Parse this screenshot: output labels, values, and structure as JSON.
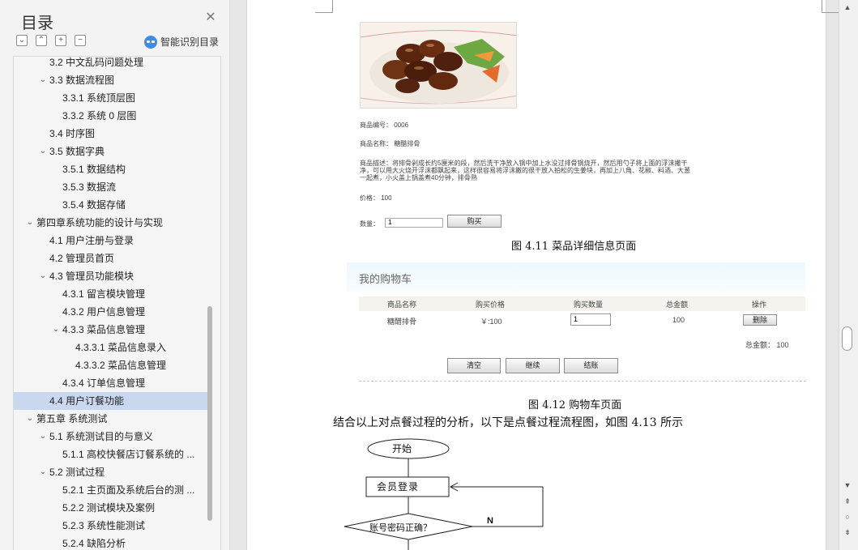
{
  "sidebar": {
    "title": "目录",
    "smart_toc_label": "智能识别目录",
    "tools": [
      "expand-all",
      "collapse-all",
      "add-heading",
      "remove-heading"
    ],
    "items": [
      {
        "label": "3.2 中文乱码问题处理",
        "level": 2,
        "expanded": null
      },
      {
        "label": "3.3 数据流程图",
        "level": 2,
        "expanded": true
      },
      {
        "label": "3.3.1 系统顶层图",
        "level": 3,
        "expanded": null
      },
      {
        "label": "3.3.2 系统 0 层图",
        "level": 3,
        "expanded": null
      },
      {
        "label": "3.4 时序图",
        "level": 2,
        "expanded": null
      },
      {
        "label": "3.5  数据字典",
        "level": 2,
        "expanded": true
      },
      {
        "label": "3.5.1  数据结构",
        "level": 3,
        "expanded": null
      },
      {
        "label": "3.5.3  数据流",
        "level": 3,
        "expanded": null
      },
      {
        "label": "3.5.4 数据存储",
        "level": 3,
        "expanded": null
      },
      {
        "label": "第四章系统功能的设计与实现",
        "level": 1,
        "expanded": true
      },
      {
        "label": "4.1 用户注册与登录",
        "level": 2,
        "expanded": null
      },
      {
        "label": "4.2 管理员首页",
        "level": 2,
        "expanded": null
      },
      {
        "label": "4.3 管理员功能模块",
        "level": 2,
        "expanded": true
      },
      {
        "label": "4.3.1 留言模块管理",
        "level": 3,
        "expanded": null
      },
      {
        "label": "4.3.2 用户信息管理",
        "level": 3,
        "expanded": null
      },
      {
        "label": "4.3.3 菜品信息管理",
        "level": 3,
        "expanded": true
      },
      {
        "label": "4.3.3.1 菜品信息录入",
        "level": 4,
        "expanded": null
      },
      {
        "label": "4.3.3.2 菜品信息管理",
        "level": 4,
        "expanded": null
      },
      {
        "label": "4.3.4 订单信息管理",
        "level": 3,
        "expanded": null
      },
      {
        "label": "4.4 用户订餐功能",
        "level": 2,
        "expanded": null,
        "selected": true
      },
      {
        "label": "第五章  系统测试",
        "level": 1,
        "expanded": true
      },
      {
        "label": "5.1 系统测试目的与意义",
        "level": 2,
        "expanded": true
      },
      {
        "label": "5.1.1  高校快餐店订餐系统的 ...",
        "level": 3,
        "expanded": null
      },
      {
        "label": "5.2 测试过程",
        "level": 2,
        "expanded": true
      },
      {
        "label": "5.2.1 主页面及系统后台的测 ...",
        "level": 3,
        "expanded": null
      },
      {
        "label": "5.2.2 测试模块及案例",
        "level": 3,
        "expanded": null
      },
      {
        "label": "5.2.3 系统性能测试",
        "level": 3,
        "expanded": null
      },
      {
        "label": "5.2.4 缺陷分析",
        "level": 3,
        "expanded": null
      }
    ]
  },
  "document": {
    "product": {
      "id_line": "商品编号： 0006",
      "name_line": "商品名称： 糖醋排骨",
      "desc_line1": "商品描述：将排骨剁成长约5厘米的段，然后洗干净放入锅中加上水没过排骨锅烧开，然后用勺子将上面的浮沫撇干",
      "desc_line2": "净，可以用大火烧开浮沫都飘起来，这样很容易将浮沫撇的很干放入拍松的生姜块，再加上八角、花椒、料酒、大葱",
      "desc_line3": "一起煮，小火盖上锅盖煮40分钟，排骨熟",
      "price_line": "价格： 100",
      "qty_label": "数量：",
      "qty_value": "1",
      "buy_button": "购买"
    },
    "figure_411_caption": "图 4.11 菜品详细信息页面",
    "cart": {
      "title": "我的购物车",
      "headers": [
        "商品名称",
        "购买价格",
        "购买数量",
        "总金额",
        "操作"
      ],
      "row": {
        "name": "糖醋排骨",
        "price": "￥:100",
        "qty": "1",
        "total": "100",
        "action": "删除"
      },
      "grand_total": "总金额： 100",
      "buttons": {
        "clear": "清空",
        "continue": "继续",
        "checkout": "结账"
      }
    },
    "figure_412_caption": "图 4.12 购物车页面",
    "paragraph": "结合以上对点餐过程的分析，以下是点餐过程流程图，如图 4.13 所示",
    "flowchart": {
      "start": "开始",
      "login": "会员登录",
      "check": "账号密码正确？",
      "no_label": "N"
    }
  }
}
